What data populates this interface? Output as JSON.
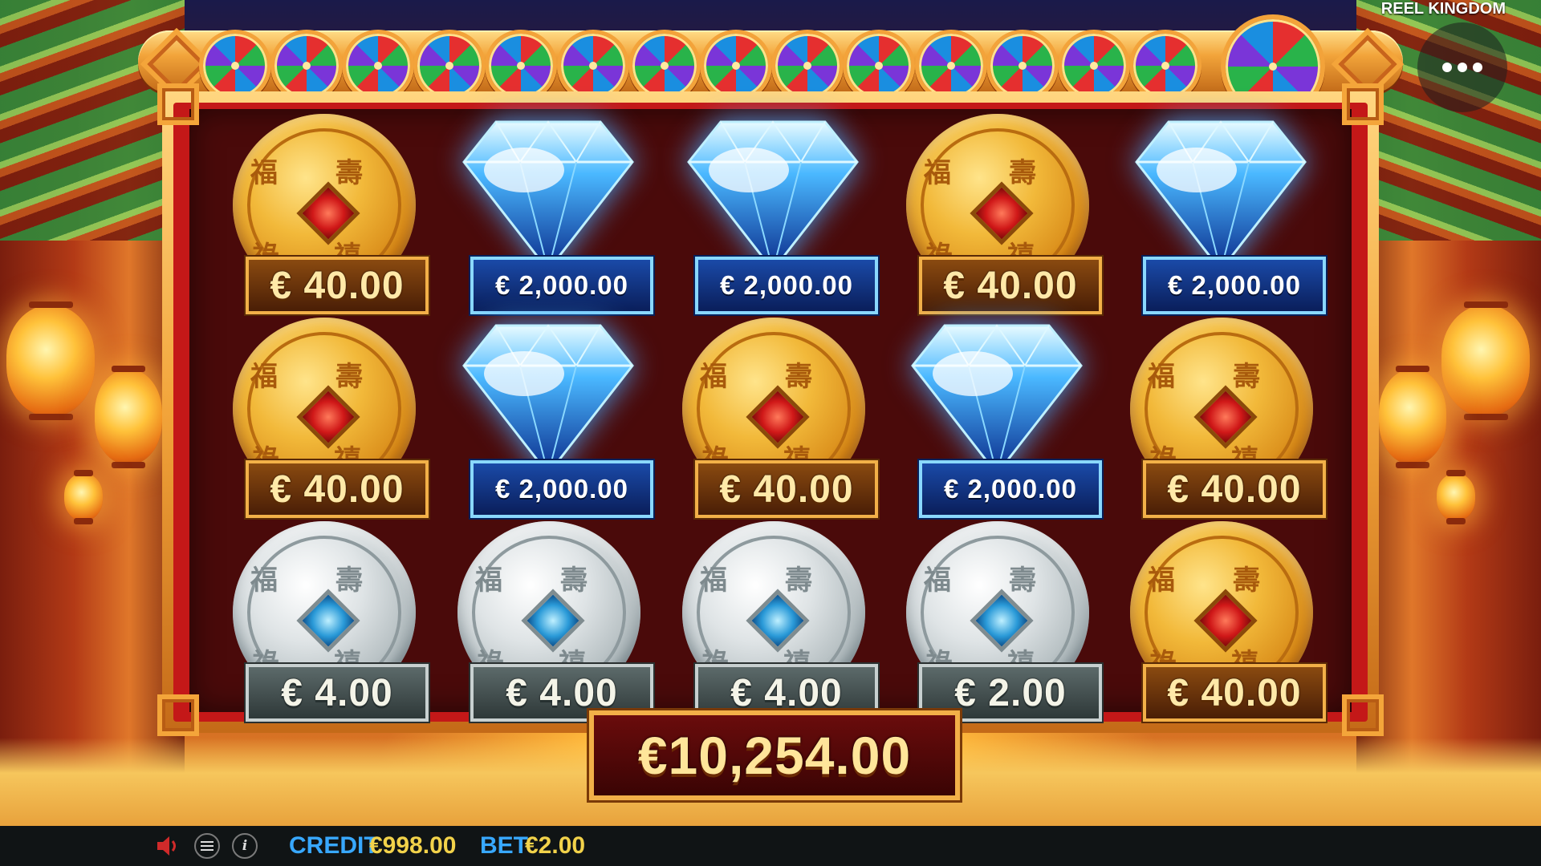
{
  "brand": "REEL KINGDOM",
  "total_win": "€10,254.00",
  "grid": [
    [
      {
        "type": "gold",
        "value": "€ 40.00"
      },
      {
        "type": "diamond",
        "value": "€ 2,000.00"
      },
      {
        "type": "diamond",
        "value": "€ 2,000.00"
      },
      {
        "type": "gold",
        "value": "€ 40.00"
      },
      {
        "type": "diamond",
        "value": "€ 2,000.00"
      }
    ],
    [
      {
        "type": "gold",
        "value": "€ 40.00"
      },
      {
        "type": "diamond",
        "value": "€ 2,000.00"
      },
      {
        "type": "gold",
        "value": "€ 40.00"
      },
      {
        "type": "diamond",
        "value": "€ 2,000.00"
      },
      {
        "type": "gold",
        "value": "€ 40.00"
      }
    ],
    [
      {
        "type": "silver",
        "value": "€ 4.00"
      },
      {
        "type": "silver",
        "value": "€ 4.00"
      },
      {
        "type": "silver",
        "value": "€ 4.00"
      },
      {
        "type": "silver",
        "value": "€ 2.00"
      },
      {
        "type": "gold",
        "value": "€ 40.00"
      }
    ]
  ],
  "status_bar": {
    "credit_label": "CREDIT",
    "credit_value": "€998.00",
    "bet_label": "BET",
    "bet_value": "€2.00"
  },
  "icons": {
    "sound": "speaker-icon",
    "menu": "hamburger-icon",
    "info": "info-icon",
    "options": "more-dots-icon"
  },
  "colors": {
    "credit_label": "#38a8ff",
    "credit_value": "#f2d24a",
    "gold_plate_border": "#f2b048",
    "diamond_plate_border": "#8ad8ff"
  }
}
